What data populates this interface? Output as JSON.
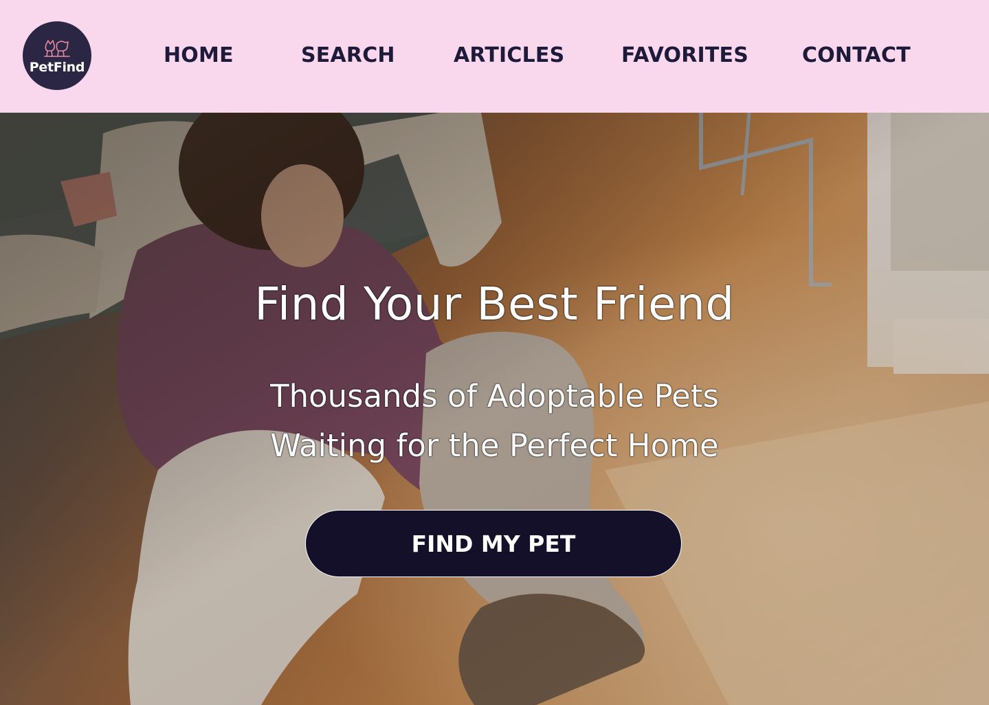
{
  "brand": {
    "name": "PetFind",
    "logo_icon": "cat-dog-icon",
    "background": "#2b2644"
  },
  "nav": {
    "items": [
      {
        "label": "HOME"
      },
      {
        "label": "SEARCH"
      },
      {
        "label": "ARTICLES"
      },
      {
        "label": "FAVORITES"
      },
      {
        "label": "CONTACT"
      }
    ],
    "background": "#f9d8ee",
    "text_color": "#1d1a3a"
  },
  "hero": {
    "title": "Find Your Best Friend",
    "subtitle_line1": "Thousands of Adoptable Pets",
    "subtitle_line2": "Waiting for the Perfect Home",
    "cta_label": "FIND MY PET",
    "cta_color": "#141029"
  }
}
